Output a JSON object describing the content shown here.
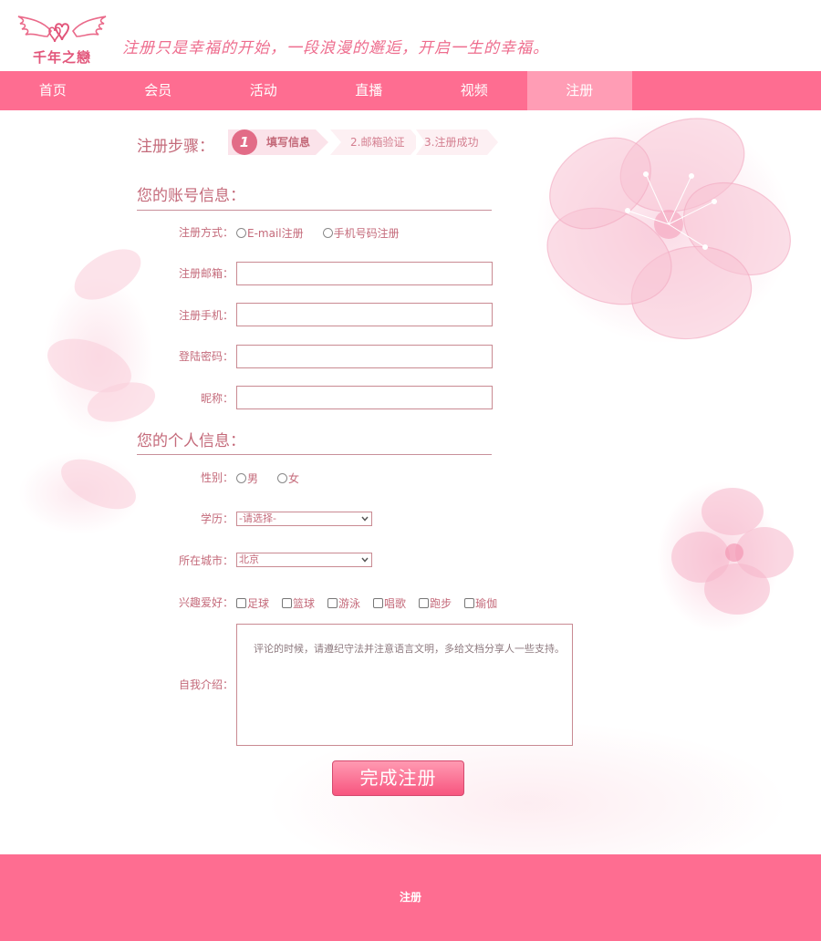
{
  "header": {
    "logo_text": "千年之戀",
    "slogan": "注册只是幸福的开始，一段浪漫的邂逅，开启一生的幸福。"
  },
  "nav": {
    "items": [
      {
        "label": "首页"
      },
      {
        "label": "会员"
      },
      {
        "label": "活动"
      },
      {
        "label": "直播"
      },
      {
        "label": "视频"
      },
      {
        "label": "注册"
      }
    ],
    "active_index": 5
  },
  "steps": {
    "label": "注册步骤：",
    "step1_number": "1",
    "step1_text": "填写信息",
    "step2_text": "2.邮箱验证",
    "step3_text": "3.注册成功"
  },
  "account": {
    "title": "您的账号信息：",
    "method_label": "注册方式：",
    "method_options": [
      "E-mail注册",
      "手机号码注册"
    ],
    "email_label": "注册邮箱：",
    "phone_label": "注册手机：",
    "password_label": "登陆密码：",
    "nickname_label": "昵称："
  },
  "personal": {
    "title": "您的个人信息：",
    "gender_label": "性别：",
    "gender_options": [
      "男",
      "女"
    ],
    "education_label": "学历：",
    "education_value": "-请选择-",
    "city_label": "所在城市：",
    "city_value": "北京",
    "hobby_label": "兴趣爱好：",
    "hobbies": [
      "足球",
      "篮球",
      "游泳",
      "唱歌",
      "跑步",
      "瑜伽"
    ],
    "intro_label": "自我介绍：",
    "intro_placeholder": "评论的时候，请遵纪守法并注意语言文明，多给文档分享人一些支持。"
  },
  "submit_label": "完成注册",
  "footer_text": "注册",
  "colors": {
    "brand_pink": "#fe6d91",
    "nav_active": "#ff9db5",
    "label_text": "#c46a7a"
  }
}
